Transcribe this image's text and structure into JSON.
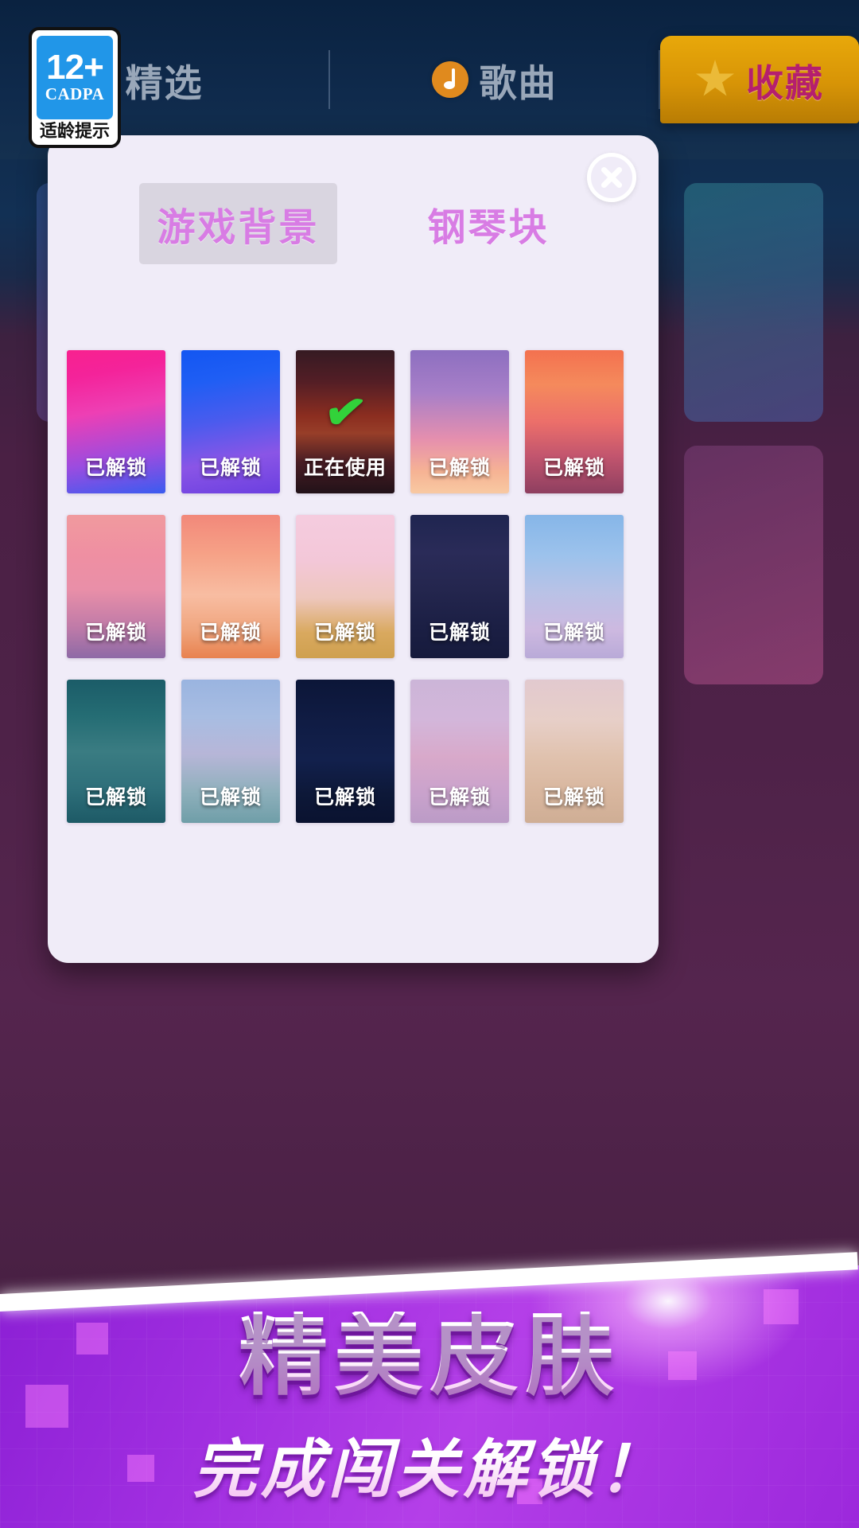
{
  "nav": {
    "tabs": [
      {
        "label": "精选",
        "icon": "",
        "active": false
      },
      {
        "label": "歌曲",
        "icon": "music-note-icon",
        "active": false
      },
      {
        "label": "收藏",
        "icon": "star-icon",
        "active": true
      }
    ]
  },
  "age_badge": {
    "age": "12+",
    "org": "CADPA",
    "tip": "适龄提示"
  },
  "modal": {
    "close_icon": "close-icon",
    "tabs": [
      {
        "label": "游戏背景",
        "selected": true
      },
      {
        "label": "钢琴块",
        "selected": false
      }
    ],
    "status_unlocked": "已解锁",
    "status_in_use": "正在使用",
    "check_icon": "check-icon",
    "rows": [
      [
        {
          "status": "已解锁",
          "state": "unlocked",
          "art": "pink-magenta-bokeh",
          "css": "linear-gradient(170deg,#f8218f 0%,#f4239a 18%,#ee3fb4 42%,#9a4ce0 74%,#3a5cf0 100%)"
        },
        {
          "status": "已解锁",
          "state": "unlocked",
          "art": "blue-violet-bokeh",
          "css": "linear-gradient(170deg,#1356f2 0%,#1f5ef4 22%,#4a5bee 48%,#8a55e6 74%,#6b3fe0 100%)"
        },
        {
          "status": "正在使用",
          "state": "in-use",
          "art": "sunset-piano-couple",
          "css": "linear-gradient(180deg,#4a2630 0%,#7a2c35 22%,#d4452c 46%,#e8603a 58%,#6a2b33 78%,#2a1820 100%)"
        },
        {
          "status": "已解锁",
          "state": "unlocked",
          "art": "purple-pink-sky",
          "css": "linear-gradient(180deg,#8d6fc0 0%,#a87fc8 30%,#e58fae 62%,#f6b394 85%,#f8c9a2 100%)"
        },
        {
          "status": "已解锁",
          "state": "unlocked",
          "art": "orange-sunset-mountains",
          "css": "linear-gradient(180deg,#f3714f 0%,#f58a5c 24%,#ec6f6a 50%,#c2556e 74%,#8e3f60 100%)"
        }
      ],
      [
        {
          "status": "已解锁",
          "state": "unlocked",
          "art": "pink-planet-mountains",
          "css": "linear-gradient(180deg,#f09a9e 0%,#ef8fa2 28%,#e98fa8 52%,#c07ba8 78%,#8e6aa6 100%)"
        },
        {
          "status": "已解锁",
          "state": "unlocked",
          "art": "peach-cloud-sky",
          "css": "linear-gradient(180deg,#f2887a 0%,#f6a287 28%,#f8bda2 56%,#f0a57e 80%,#e8824f 100%)"
        },
        {
          "status": "已解锁",
          "state": "unlocked",
          "art": "girl-umbrella-golden-tree",
          "css": "linear-gradient(180deg,#f5ccdf 0%,#f3c7d8 32%,#eec7bd 58%,#d9a95f 82%,#cfa04f 100%)"
        },
        {
          "status": "已解锁",
          "state": "unlocked",
          "art": "orange-lanterns-night-moon",
          "css": "linear-gradient(180deg,#1f2550 0%,#2a2b58 26%,#24264e 52%,#1b1f44 78%,#161a3c 100%)"
        },
        {
          "status": "已解锁",
          "state": "unlocked",
          "art": "girl-on-cloud-blue",
          "css": "linear-gradient(180deg,#86b6e8 0%,#9cc2ec 28%,#b9c2e6 54%,#cdb9e0 80%,#b9aad8 100%)"
        }
      ],
      [
        {
          "status": "已解锁",
          "state": "unlocked",
          "art": "polar-bear-icebergs",
          "css": "linear-gradient(180deg,#1b5c68 0%,#256d74 26%,#3a7c82 50%,#2e6f7a 76%,#1d5a66 100%)"
        },
        {
          "status": "已解锁",
          "state": "unlocked",
          "art": "blue-whale-sky",
          "css": "linear-gradient(180deg,#9ab4e0 0%,#a8bde2 26%,#b7b6d8 52%,#8fb0bc 78%,#6f9ea8 100%)"
        },
        {
          "status": "已解锁",
          "state": "unlocked",
          "art": "yellow-moon-city-skyline",
          "css": "linear-gradient(180deg,#0c1638 0%,#101c44 30%,#12204c 56%,#0d1838 80%,#0a1230 100%)"
        },
        {
          "status": "已解锁",
          "state": "unlocked",
          "art": "pink-swan-girl-branches",
          "css": "linear-gradient(180deg,#ccb5d8 0%,#d3b6da 28%,#d8a9ca 54%,#c9a2cc 80%,#bb9bc6 100%)"
        },
        {
          "status": "已解锁",
          "state": "unlocked",
          "art": "beige-clouds-horse",
          "css": "linear-gradient(180deg,#e2c9cf 0%,#e7cfc8 28%,#e0c2ae 54%,#d8b69e 80%,#cfae95 100%)"
        }
      ]
    ]
  },
  "promo": {
    "line1": "精美皮肤",
    "line2": "完成闯关解锁！"
  },
  "colors": {
    "accent_purple": "#a02ee0",
    "tab_active_gold": "#d79406",
    "tab_active_text": "#b51f6e",
    "modal_bg": "#f0ecf8",
    "tab_text": "#d87ce4",
    "check_green": "#32d23a",
    "cadpa_blue": "#2196e8"
  }
}
